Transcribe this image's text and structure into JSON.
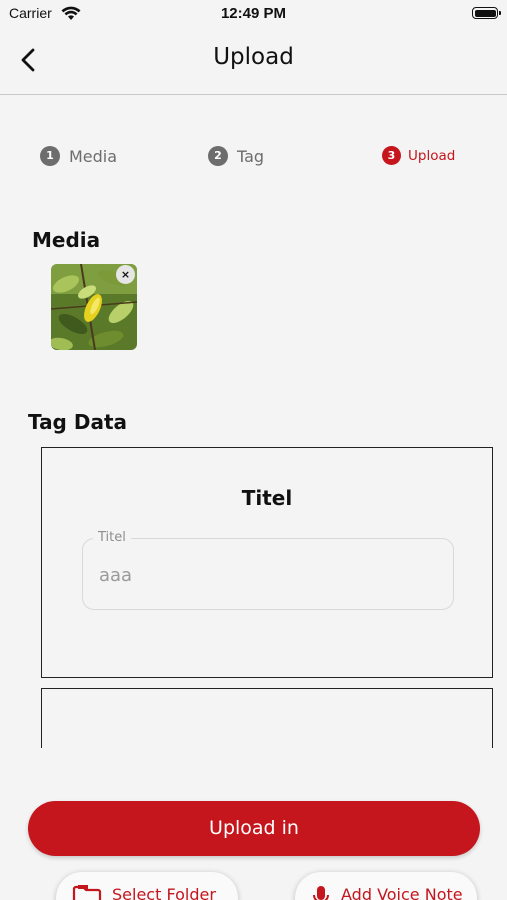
{
  "status_bar": {
    "carrier": "Carrier",
    "time": "12:49 PM"
  },
  "nav": {
    "title": "Upload",
    "back_icon": "chevron-left-icon"
  },
  "stepper": {
    "steps": [
      {
        "number": "1",
        "label": "Media",
        "active": false
      },
      {
        "number": "2",
        "label": "Tag",
        "active": false
      },
      {
        "number": "3",
        "label": "Upload",
        "active": true
      }
    ]
  },
  "media": {
    "title": "Media",
    "remove_glyph": "×"
  },
  "tag_data": {
    "title": "Tag Data",
    "card_heading": "Titel",
    "field_label": "Titel",
    "field_value": "aaa"
  },
  "actions": {
    "upload_label": "Upload in",
    "select_folder_label": "Select Folder",
    "add_voice_note_label": "Add Voice Note"
  },
  "colors": {
    "accent": "#c4161c",
    "inactive_step": "#6d6d6d",
    "background": "#f4f4f4"
  }
}
